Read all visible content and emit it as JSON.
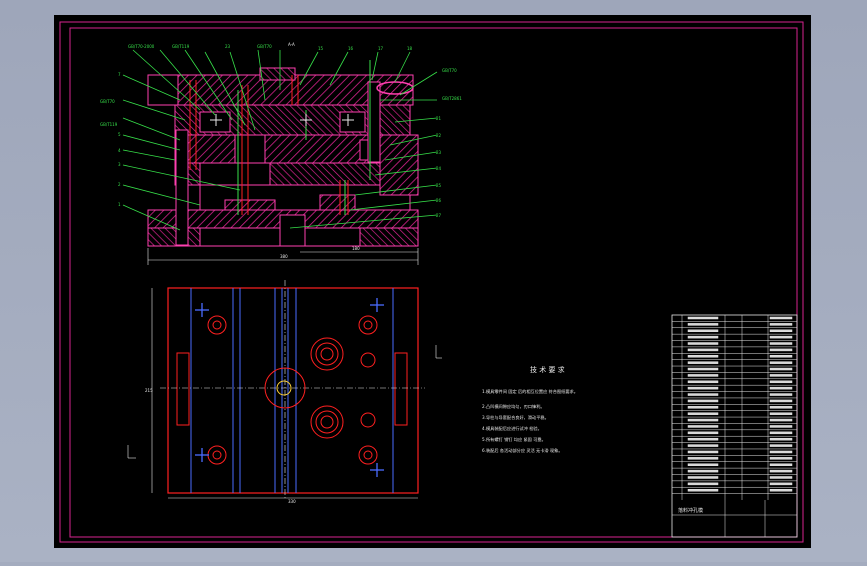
{
  "tech_requirements": {
    "title": "技 术 要 求",
    "lines": [
      "1.模具零件间 固定 后的相互位置应 符合图纸要求。",
      "2.凸凹模间隙应均匀，刃口锋利。",
      "3.导柱与导套配合良好，滑动平稳。",
      "4.模具装配后应进行试冲 检验。",
      "5.所有螺钉 销钉 均应 紧固 可靠。",
      "6.装配后 各活动部分应 灵活 无卡滞 现象。"
    ]
  },
  "dimensions": {
    "section_width": "380",
    "section_right": "180",
    "plan_width": "330",
    "plan_height": "215"
  },
  "section_label": "A-A",
  "title_block": {
    "name": "落料冲孔模",
    "rows": 29
  },
  "colors": {
    "background": "#000000",
    "frame": "#d8238f",
    "red": "#ff2020",
    "magenta": "#ff3fb0",
    "green": "#37e14a",
    "white": "#e8e8e8",
    "blue": "#4a6cff",
    "cyan": "#5fd0ff"
  }
}
